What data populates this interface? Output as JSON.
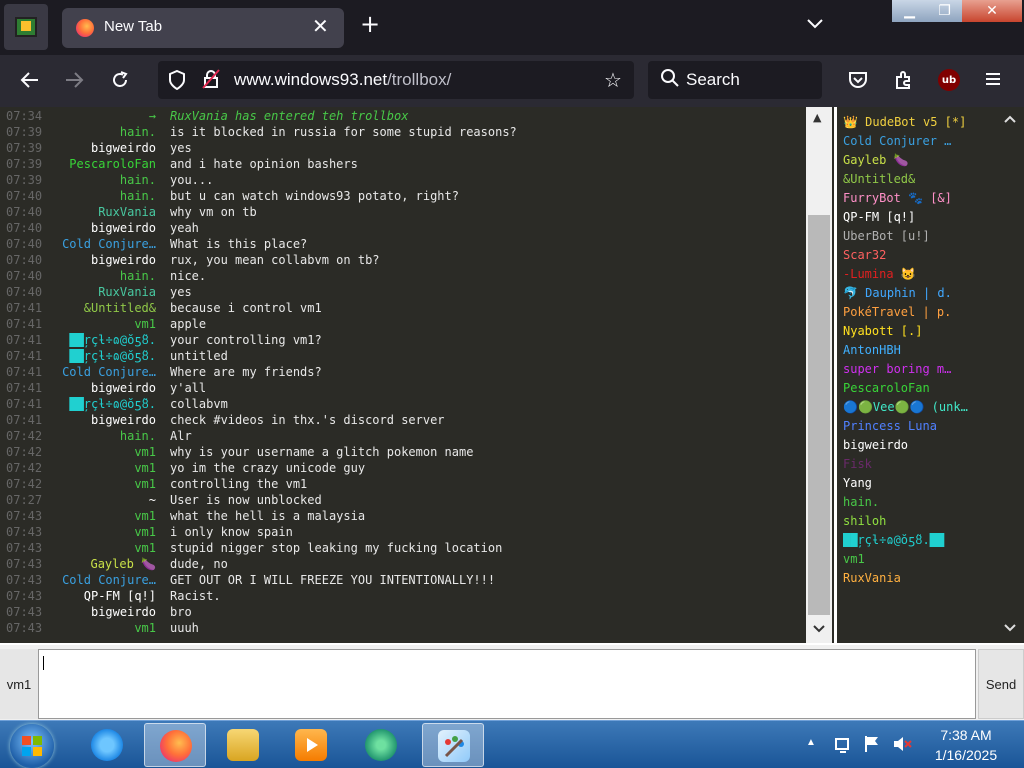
{
  "browser": {
    "tab_title": "New Tab",
    "url_host": "www.windows93.net",
    "url_path": "/trollbox/",
    "search_label": "Search"
  },
  "chat": {
    "messages": [
      {
        "time": "07:34",
        "nick": "→",
        "nick_color": "#48c848",
        "msg": "RuxVania has entered teh trollbox",
        "msg_color": "#48c848"
      },
      {
        "time": "07:39",
        "nick": "hain.",
        "nick_color": "#48c848",
        "msg": "is it blocked in russia for some stupid reasons?"
      },
      {
        "time": "07:39",
        "nick": "bigweirdo",
        "nick_color": "#ffffff",
        "msg": "yes"
      },
      {
        "time": "07:39",
        "nick": "PescaroloFan",
        "nick_color": "#38d438",
        "msg": "and i hate opinion bashers"
      },
      {
        "time": "07:39",
        "nick": "hain.",
        "nick_color": "#48c848",
        "msg": "you..."
      },
      {
        "time": "07:40",
        "nick": "hain.",
        "nick_color": "#48c848",
        "msg": "but u can watch windows93 potato, right?"
      },
      {
        "time": "07:40",
        "nick": "RuxVania",
        "nick_color": "#48c8a0",
        "msg": "why vm on tb"
      },
      {
        "time": "07:40",
        "nick": "bigweirdo",
        "nick_color": "#ffffff",
        "msg": "yeah"
      },
      {
        "time": "07:40",
        "nick": "Cold Conjure…",
        "nick_color": "#3aa0e0",
        "msg": "What is this place?"
      },
      {
        "time": "07:40",
        "nick": "bigweirdo",
        "nick_color": "#ffffff",
        "msg": "rux, you mean collabvm on tb?"
      },
      {
        "time": "07:40",
        "nick": "hain.",
        "nick_color": "#48c848",
        "msg": "nice."
      },
      {
        "time": "07:40",
        "nick": "RuxVania",
        "nick_color": "#48c8a0",
        "msg": "yes"
      },
      {
        "time": "07:41",
        "nick": "&Untitled&",
        "nick_color": "#90c848",
        "msg": "because i control vm1"
      },
      {
        "time": "07:41",
        "nick": "vm1",
        "nick_color": "#48c848",
        "msg": "apple"
      },
      {
        "time": "07:41",
        "nick": "██ŗçƚ÷ɷ@ŏƽ̃ȣ.ٜ",
        "nick_color": "#20d0d0",
        "msg": "your controlling vm1?"
      },
      {
        "time": "07:41",
        "nick": "██ŗçƚ÷ɷ@ŏƽ̃ȣ.ٜ",
        "nick_color": "#20d0d0",
        "msg": "untitled"
      },
      {
        "time": "07:41",
        "nick": "Cold Conjure…",
        "nick_color": "#3aa0e0",
        "msg": "Where are my friends?"
      },
      {
        "time": "07:41",
        "nick": "bigweirdo",
        "nick_color": "#ffffff",
        "msg": "y'all"
      },
      {
        "time": "07:41",
        "nick": "██ŗçƚ÷ɷ@ŏƽ̃ȣ.ٜ",
        "nick_color": "#20d0d0",
        "msg": "collabvm"
      },
      {
        "time": "07:41",
        "nick": "bigweirdo",
        "nick_color": "#ffffff",
        "msg": "check #videos in thx.'s discord server"
      },
      {
        "time": "07:42",
        "nick": "hain.",
        "nick_color": "#48c848",
        "msg": "Alr"
      },
      {
        "time": "07:42",
        "nick": "vm1",
        "nick_color": "#48c848",
        "msg": "why is your username a glitch pokemon name"
      },
      {
        "time": "07:42",
        "nick": "vm1",
        "nick_color": "#48c848",
        "msg": "yo im the crazy unicode guy"
      },
      {
        "time": "07:42",
        "nick": "vm1",
        "nick_color": "#48c848",
        "msg": "controlling the vm1"
      },
      {
        "time": "07:27",
        "nick": "~",
        "nick_color": "#ffffff",
        "msg": "User is now unblocked"
      },
      {
        "time": "07:43",
        "nick": "vm1",
        "nick_color": "#48c848",
        "msg": "what the hell is a malaysia"
      },
      {
        "time": "07:43",
        "nick": "vm1",
        "nick_color": "#48c848",
        "msg": "i only know spain"
      },
      {
        "time": "07:43",
        "nick": "vm1",
        "nick_color": "#48c848",
        "msg": "stupid nigger stop leaking my fucking location"
      },
      {
        "time": "07:43",
        "nick": "Gayleb 🍆",
        "nick_color": "#c8e048",
        "msg": "dude, no"
      },
      {
        "time": "07:43",
        "nick": "Cold Conjure…",
        "nick_color": "#3aa0e0",
        "msg": "GET OUT OR I WILL FREEZE YOU INTENTIONALLY!!!"
      },
      {
        "time": "07:43",
        "nick": "QP-FM [q!]",
        "nick_color": "#ffffff",
        "msg": "Racist."
      },
      {
        "time": "07:43",
        "nick": "bigweirdo",
        "nick_color": "#ffffff",
        "msg": "bro"
      },
      {
        "time": "07:43",
        "nick": "vm1",
        "nick_color": "#48c848",
        "msg": "uuuh"
      }
    ]
  },
  "users": [
    {
      "name": "👑 DudeBot v5 [*]",
      "color": "#f0d040"
    },
    {
      "name": "Cold Conjurer …",
      "color": "#3aa0e0"
    },
    {
      "name": "Gayleb 🍆",
      "color": "#c8e048"
    },
    {
      "name": "&Untitled&",
      "color": "#90c848"
    },
    {
      "name": "FurryBot 🐾 [&]",
      "color": "#ff90c8"
    },
    {
      "name": "QP-FM [q!]",
      "color": "#ffffff"
    },
    {
      "name": "UberBot [u!]",
      "color": "#b0b0b0"
    },
    {
      "name": "Scar32",
      "color": "#ff6060"
    },
    {
      "name": "-Lumina 😺",
      "color": "#e02020"
    },
    {
      "name": "🐬 Dauphin | d.",
      "color": "#40a8ff"
    },
    {
      "name": "PokéTravel | p.",
      "color": "#ffa040"
    },
    {
      "name": "Nyabott [.]",
      "color": "#ffe020"
    },
    {
      "name": "AntonHBH",
      "color": "#40b0ff"
    },
    {
      "name": "super boring m…",
      "color": "#d030f0"
    },
    {
      "name": "PescaroloFan",
      "color": "#38d438"
    },
    {
      "name": "🔵🟢Vee🟢🔵 (unk…",
      "color": "#40e8c8"
    },
    {
      "name": "Princess Luna",
      "color": "#5080ff"
    },
    {
      "name": "bigweirdo",
      "color": "#ffffff"
    },
    {
      "name": "Fisk",
      "color": "#6a2a6a"
    },
    {
      "name": "Yang",
      "color": "#ffffff"
    },
    {
      "name": "hain.",
      "color": "#48c848"
    },
    {
      "name": "shiloh",
      "color": "#90e040"
    },
    {
      "name": "██ŗçƚ÷ɷ@ŏƽ̃ȣ.ٜ██",
      "color": "#20d0d0"
    },
    {
      "name": "vm1",
      "color": "#48c848"
    },
    {
      "name": "RuxVania",
      "color": "#ffb040"
    }
  ],
  "input": {
    "nick_label": "vm1",
    "send_label": "Send",
    "value": ""
  },
  "taskbar": {
    "time": "7:38 AM",
    "date": "1/16/2025"
  }
}
